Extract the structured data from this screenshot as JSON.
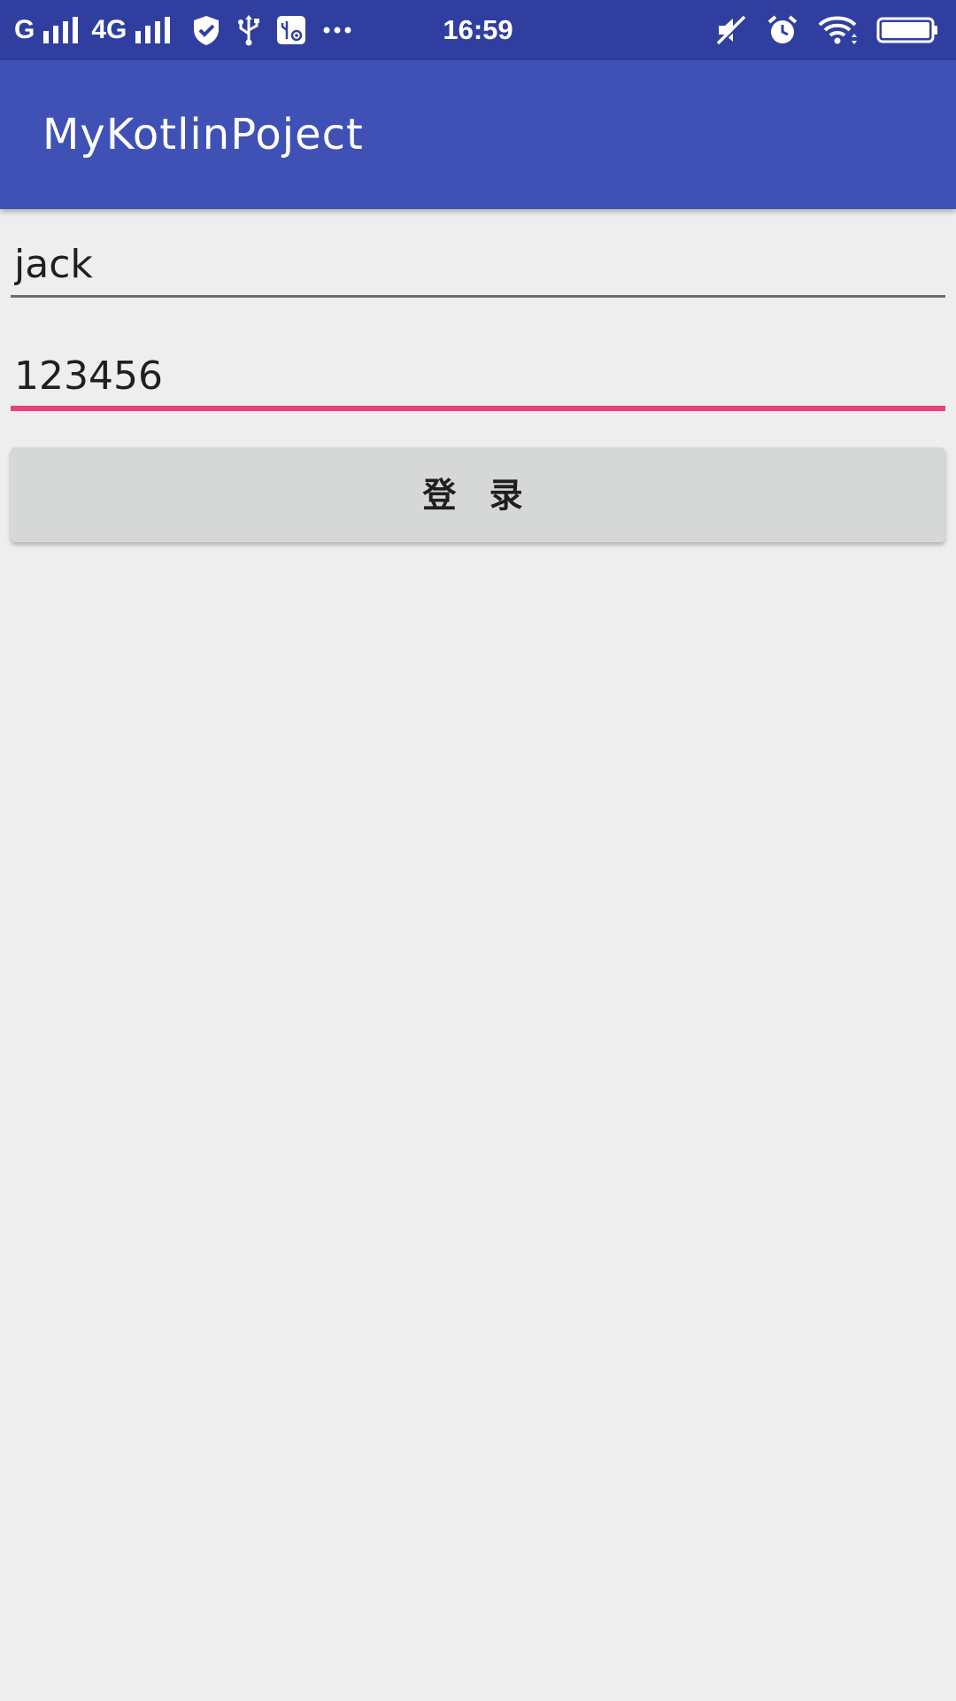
{
  "status_bar": {
    "network_1": "G",
    "network_2": "4G",
    "time": "16:59",
    "icons": [
      "signal-icon",
      "signal-icon",
      "shield-icon",
      "usb-icon",
      "usb-settings-icon",
      "more-dots-icon",
      "mute-icon",
      "alarm-icon",
      "wifi-icon",
      "battery-icon"
    ]
  },
  "app_bar": {
    "title": "MyKotlinPoject",
    "background": "#3f51b5"
  },
  "form": {
    "username_value": "jack",
    "password_value": "123456",
    "login_label": "登 录",
    "accent_color": "#ec407a"
  }
}
